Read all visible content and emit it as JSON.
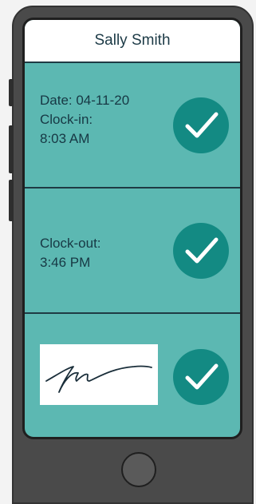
{
  "header": {
    "title": "Sally Smith"
  },
  "clock_in": {
    "date_line": "Date: 04-11-20",
    "label": "Clock-in:",
    "time": "8:03 AM"
  },
  "clock_out": {
    "label": "Clock-out:",
    "time": "3:46 PM"
  },
  "icons": {
    "check": "check-circle-icon",
    "signature": "signature-image"
  },
  "colors": {
    "screen_bg": "#5cb8b2",
    "check_bg": "#138a83",
    "text": "#173844",
    "phone_body": "#4a4a4a"
  }
}
